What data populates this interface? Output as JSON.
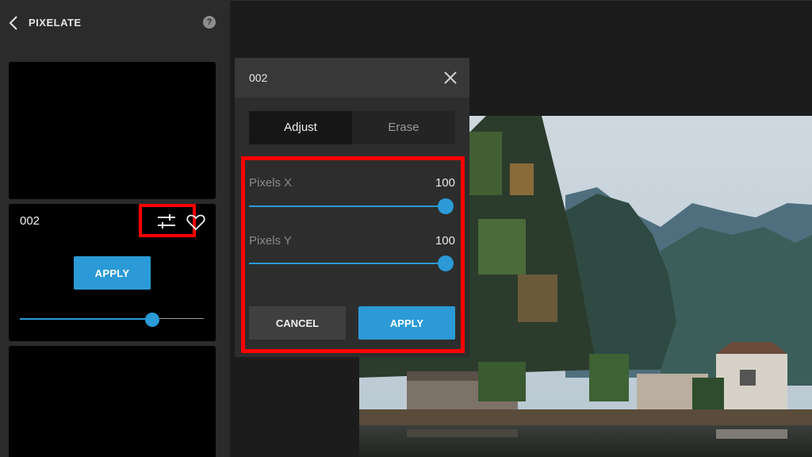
{
  "panel": {
    "title": "PIXELATE",
    "back_icon": "chevron-left-icon",
    "help_icon": "help-circle-icon",
    "help_glyph": "?",
    "preset": {
      "name": "002",
      "apply_label": "APPLY",
      "adjust_icon": "sliders-icon",
      "favorite_icon": "heart-icon",
      "intensity": 0.72
    }
  },
  "dialog": {
    "title": "002",
    "close_icon": "close-icon",
    "tabs": [
      {
        "label": "Adjust",
        "active": true
      },
      {
        "label": "Erase",
        "active": false
      }
    ],
    "params": [
      {
        "label": "Pixels X",
        "value": "100",
        "fraction": 1.0
      },
      {
        "label": "Pixels Y",
        "value": "100",
        "fraction": 1.0
      }
    ],
    "cancel_label": "CANCEL",
    "apply_label": "APPLY"
  },
  "colors": {
    "accent": "#2b9ad6",
    "highlight": "#ff0000",
    "panel_bg": "#2b2b2b",
    "dialog_bg": "#2d2d2d"
  }
}
